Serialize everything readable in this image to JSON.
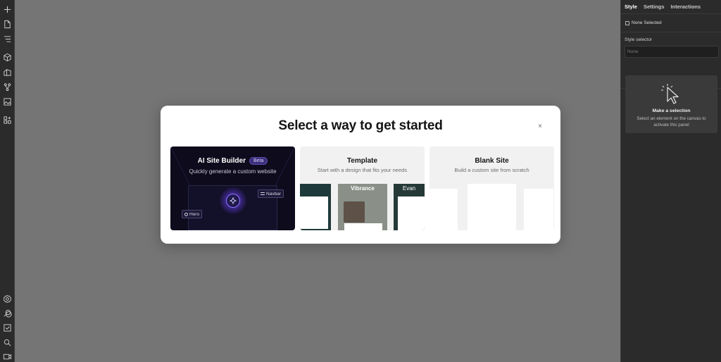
{
  "left_toolbar": {
    "top_icons": [
      "plus-icon",
      "page-icon",
      "navigator-icon",
      "components-icon",
      "cms-icon",
      "ecommerce-icon",
      "assets-icon",
      "apps-icon"
    ],
    "bottom_icons": [
      "settings-icon",
      "help-icon",
      "audit-icon",
      "search-icon",
      "video-icon"
    ]
  },
  "right_panel": {
    "tabs": [
      {
        "label": "Style",
        "active": true
      },
      {
        "label": "Settings",
        "active": false
      },
      {
        "label": "Interactions",
        "active": false
      }
    ],
    "none_selected": "None Selected",
    "style_selector_label": "Style selector",
    "style_selector_placeholder": "None",
    "empty_state": {
      "title": "Make a selection",
      "description": "Select an element on the canvas to activate this panel"
    }
  },
  "modal": {
    "title": "Select a way to get started",
    "close_icon": "×",
    "cards": {
      "ai": {
        "title": "AI Site Builder",
        "badge": "Beta",
        "subtitle": "Quickly generate a custom website",
        "chip_navbar": "Navbar",
        "chip_hero": "Hero"
      },
      "template": {
        "title": "Template",
        "subtitle": "Start with a design that fits your needs",
        "preview_mid_heading": "Vibrance",
        "preview_right_heading": "Evan"
      },
      "blank": {
        "title": "Blank Site",
        "subtitle": "Build a custom site from scratch"
      }
    }
  },
  "colors": {
    "canvas": "#757575",
    "panel": "#2b2b2b",
    "ai_card": "#0d0b1c",
    "accent": "#8e74ff"
  }
}
